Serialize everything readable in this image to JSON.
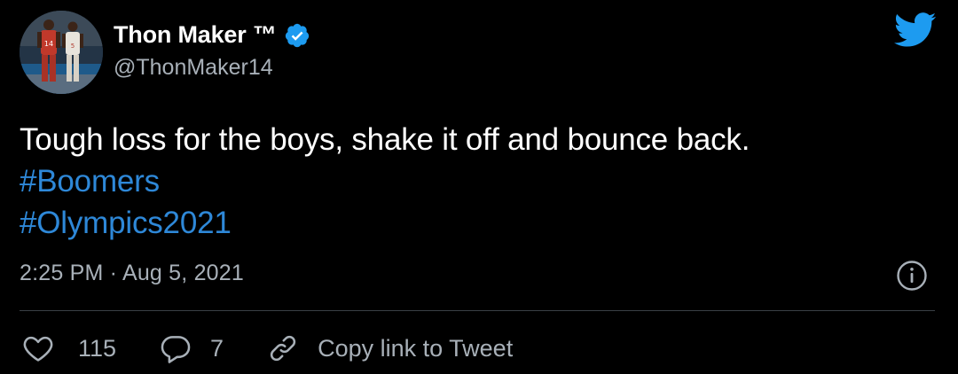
{
  "author": {
    "display_name": "Thon Maker ™",
    "handle": "@ThonMaker14",
    "verified": true,
    "avatar_icon": "profile-photo-avatar"
  },
  "tweet": {
    "text_lines": [
      "Tough loss for the boys, shake it off and bounce back."
    ],
    "hashtags": [
      "#Boomers",
      "#Olympics2021"
    ],
    "timestamp": "2:25 PM · Aug 5, 2021"
  },
  "actions": {
    "likes": "115",
    "replies": "7",
    "copy_link_label": "Copy link to Tweet"
  },
  "icons": {
    "brand": "twitter-bird-icon",
    "verified": "verified-badge-icon",
    "info": "info-icon",
    "like": "heart-icon",
    "reply": "reply-bubble-icon",
    "link": "link-icon"
  },
  "colors": {
    "background": "#000000",
    "primary_text": "#ffffff",
    "secondary_text": "#a8b0b8",
    "accent": "#1d9bf0",
    "hashtag": "#2e88d8",
    "divider": "#3a3f45"
  }
}
